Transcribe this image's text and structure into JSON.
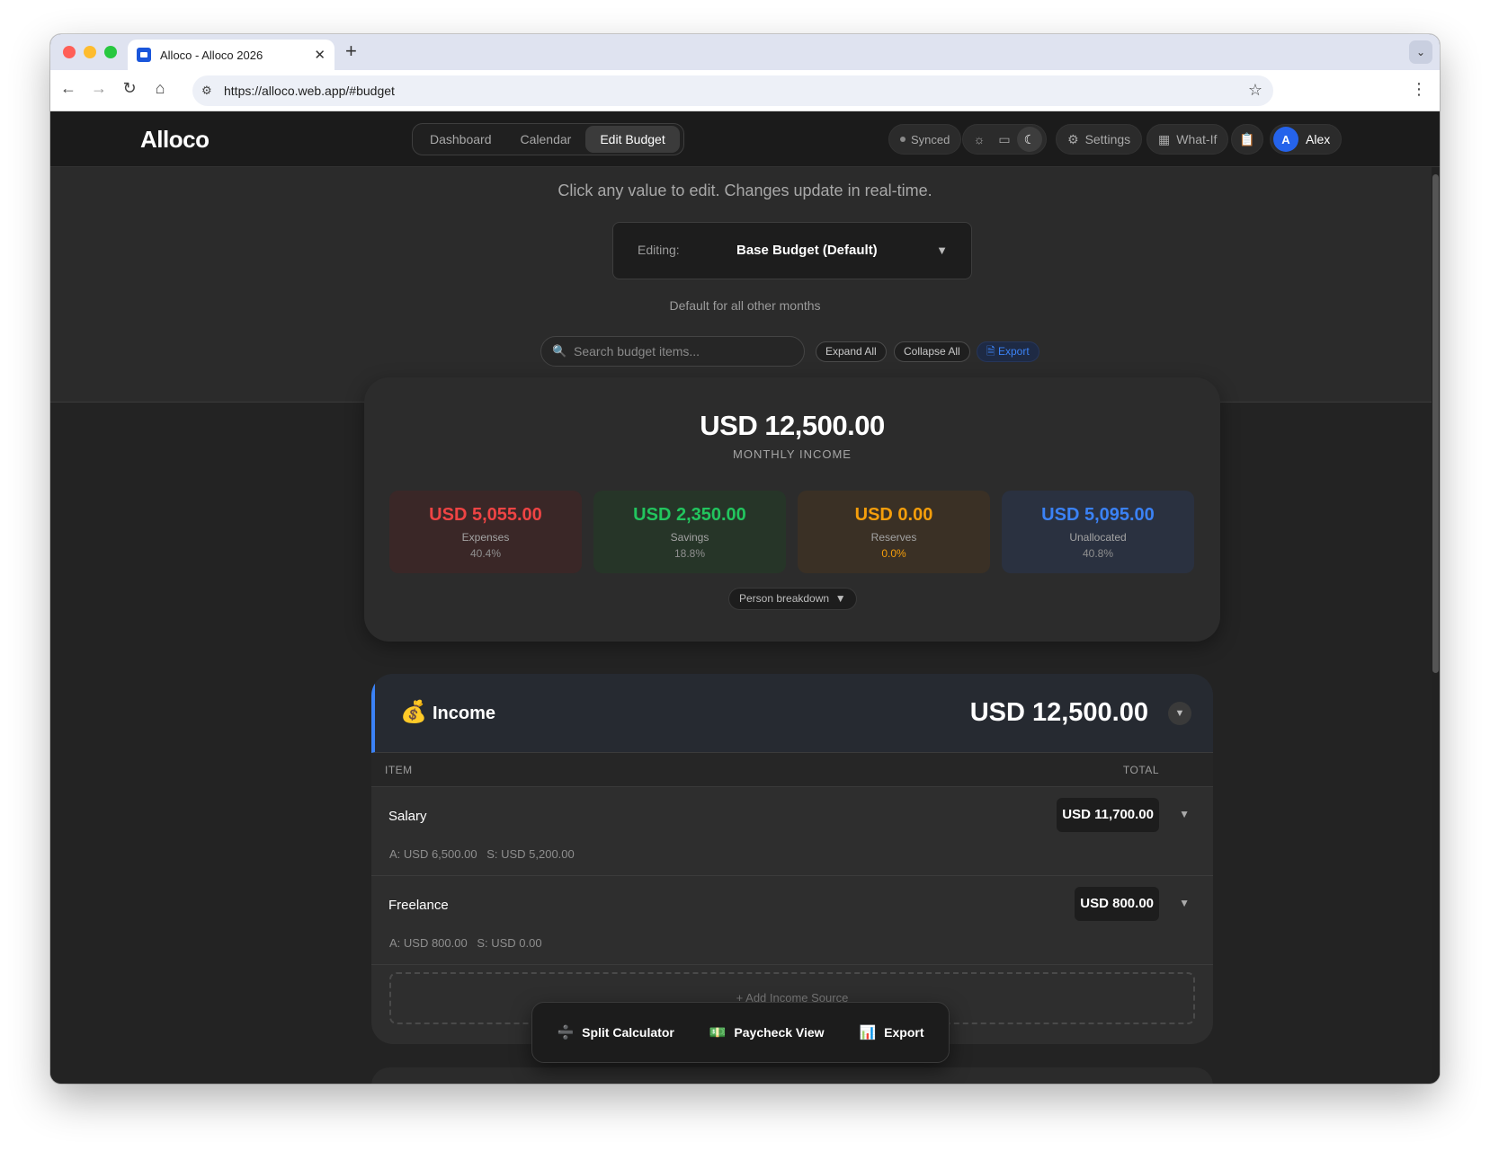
{
  "browser": {
    "tab_title": "Alloco - Alloco 2026",
    "url": "https://alloco.web.app/#budget"
  },
  "header": {
    "brand": "Alloco",
    "nav": [
      "Dashboard",
      "Calendar",
      "Edit Budget"
    ],
    "active_nav": "Edit Budget",
    "synced_label": "Synced",
    "settings_label": "Settings",
    "whatif_label": "What-If",
    "user_initial": "A",
    "user_name": "Alex",
    "theme_modes": [
      "light",
      "system",
      "dark"
    ],
    "active_theme": "dark"
  },
  "editor": {
    "hint": "Click any value to edit. Changes update in real-time.",
    "editing_label": "Editing:",
    "editing_value": "Base Budget (Default)",
    "default_note": "Default for all other months",
    "search_placeholder": "Search budget items...",
    "expand_all": "Expand All",
    "collapse_all": "Collapse All",
    "export": "Export"
  },
  "summary": {
    "total": "USD 12,500.00",
    "total_label": "MONTHLY INCOME",
    "stats": [
      {
        "value": "USD 5,055.00",
        "label": "Expenses",
        "percent": "40.4%",
        "color": "#ef4444"
      },
      {
        "value": "USD 2,350.00",
        "label": "Savings",
        "percent": "18.8%",
        "color": "#22c55e"
      },
      {
        "value": "USD 0.00",
        "label": "Reserves",
        "percent": "0.0%",
        "color": "#f59e0b"
      },
      {
        "value": "USD 5,095.00",
        "label": "Unallocated",
        "percent": "40.8%",
        "color": "#3b82f6"
      }
    ],
    "person_breakdown": "Person breakdown"
  },
  "income": {
    "title": "Income",
    "total": "USD 12,500.00",
    "col_item": "ITEM",
    "col_total": "TOTAL",
    "rows": [
      {
        "name": "Salary",
        "value": "USD 11,700.00",
        "a": "A: USD 6,500.00",
        "s": "S: USD 5,200.00"
      },
      {
        "name": "Freelance",
        "value": "USD 800.00",
        "a": "A: USD 800.00",
        "s": "S: USD 0.00"
      }
    ],
    "add_source": "+ Add Income Source"
  },
  "toolbar": {
    "split_calculator": "Split Calculator",
    "paycheck_view": "Paycheck View",
    "export": "Export"
  }
}
